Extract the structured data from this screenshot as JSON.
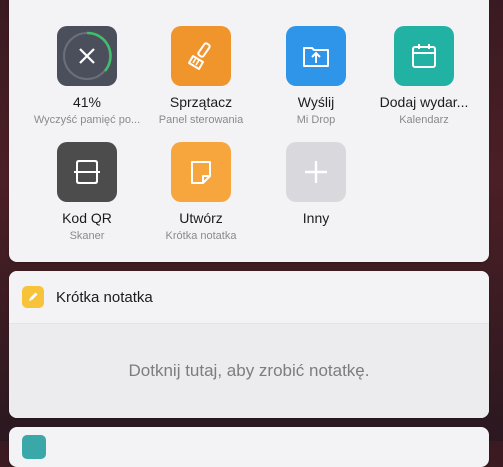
{
  "colors": {
    "cleaner_bg": "#4b4f5c",
    "cleaner_ring": "#3fbf6a",
    "sprzatacz_bg": "#f0952c",
    "wyslij_bg": "#2f95e8",
    "kalendarz_bg": "#22b2a3",
    "qr_bg": "#4c4c4c",
    "note_bg": "#f7a53d",
    "more_bg": "#d9d9dd",
    "note_header_icon": "#f7c33a"
  },
  "tiles": [
    {
      "label": "41%",
      "sub": "Wyczyść pamięć po...",
      "icon": "close-icon"
    },
    {
      "label": "Sprzątacz",
      "sub": "Panel sterowania",
      "icon": "broom-icon"
    },
    {
      "label": "Wyślij",
      "sub": "Mi Drop",
      "icon": "folder-upload-icon"
    },
    {
      "label": "Dodaj wydar...",
      "sub": "Kalendarz",
      "icon": "calendar-icon"
    },
    {
      "label": "Kod QR",
      "sub": "Skaner",
      "icon": "scanner-icon"
    },
    {
      "label": "Utwórz",
      "sub": "Krótka notatka",
      "icon": "note-icon"
    },
    {
      "label": "Inny",
      "sub": "",
      "icon": "plus-icon"
    }
  ],
  "note_widget": {
    "title": "Krótka notatka",
    "placeholder": "Dotknij tutaj, aby zrobić notatkę.",
    "icon": "pencil-icon"
  }
}
